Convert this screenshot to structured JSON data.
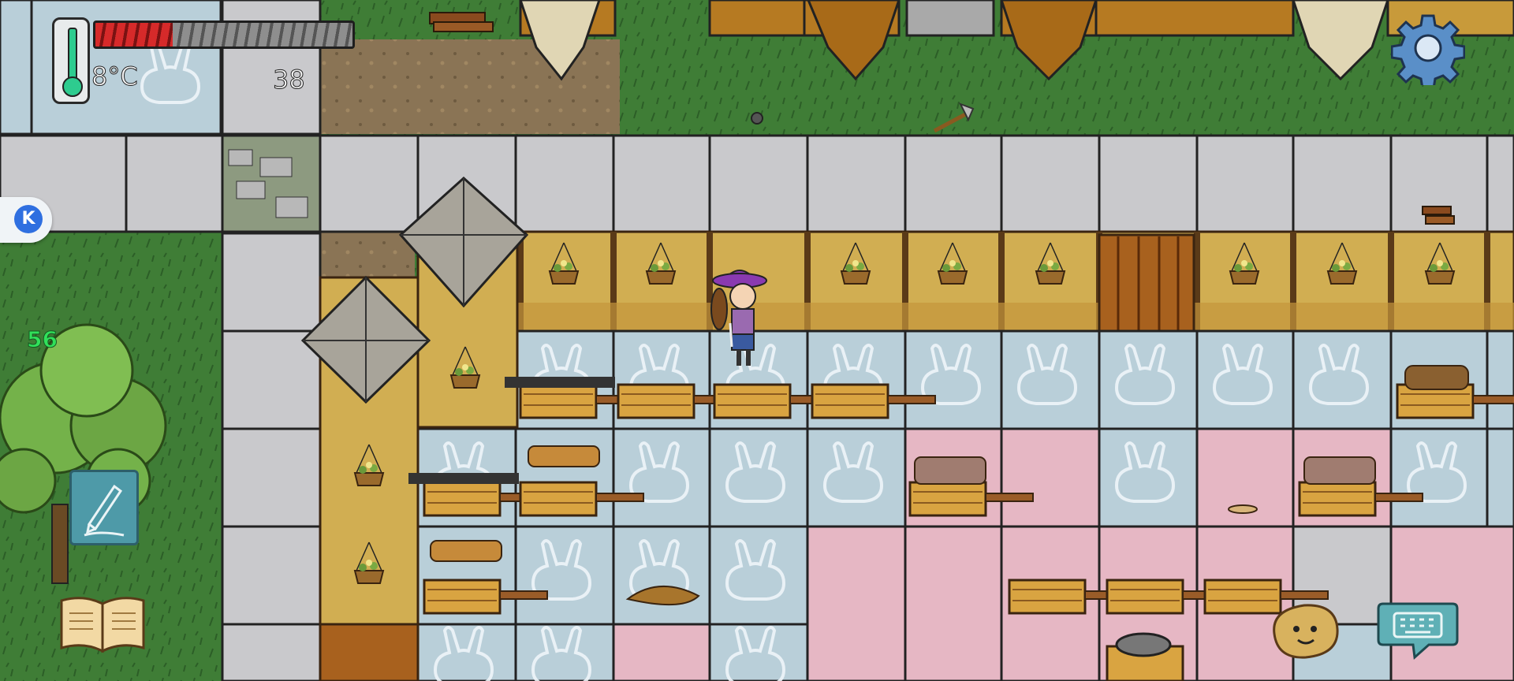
{
  "hud": {
    "temperature": "8°C",
    "resource_count": "38",
    "player_level": "56",
    "health_fraction": 0.3
  },
  "buttons": {
    "settings_icon": "gear-icon",
    "side_app_badge": "K",
    "edit_icon": "pencil-icon",
    "journal_icon": "open-book-icon",
    "character_face_icon": "potato-face-icon",
    "chat_icon": "keyboard-speech-bubble-icon"
  },
  "colors": {
    "grass": "#3f7d36",
    "stone_tile": "#c9c9cc",
    "blue_floor_tile": "#b9cfd9",
    "pink_floor_tile": "#e6b7c4",
    "wood_wall": "#c89a3a",
    "thermo_fill": "#2ecc8f",
    "health_red": "#d62a2a",
    "level_text": "#31e05a"
  }
}
